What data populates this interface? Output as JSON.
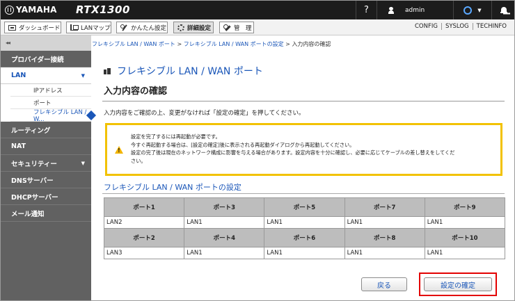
{
  "header": {
    "brand": "YAMAHA",
    "model": "RTX1300",
    "help": "?",
    "user": "admin"
  },
  "menubar": {
    "buttons": [
      {
        "label": "ダッシュボード",
        "icon": "dashboard-icon"
      },
      {
        "label": "LANマップ",
        "icon": "lanmap-icon"
      },
      {
        "label": "かんたん設定",
        "icon": "wand-icon"
      },
      {
        "label": "詳細設定",
        "icon": "gear-icon",
        "active": true
      },
      {
        "label": "管　理",
        "icon": "wrench-icon"
      }
    ],
    "right_links": [
      "CONFIG",
      "SYSLOG",
      "TECHINFO"
    ]
  },
  "sidebar": {
    "collapse": "◂◂",
    "items_top": [
      "プロバイダー接続"
    ],
    "lan": "LAN",
    "lan_sub": [
      "IPアドレス",
      "ポート",
      "フレキシブル LAN / W..."
    ],
    "items_bottom": [
      "ルーティング",
      "NAT",
      "セキュリティー",
      "DNSサーバー",
      "DHCPサーバー",
      "メール通知"
    ]
  },
  "breadcrumb": {
    "link1": "フレキシブル LAN / WAN ポート",
    "sep": " > ",
    "link2": "フレキシブル LAN / WAN ポートの設定",
    "current": "入力内容の確認"
  },
  "main": {
    "section_title": "フレキシブル LAN / WAN ポート",
    "page_title": "入力内容の確認",
    "instruction": "入力内容をご確認の上、変更がなければ「設定の確定」を押してください。",
    "warning": [
      "設定を完了するには再起動が必要です。",
      "今すぐ再起動する場合は、[設定の確定]後に表示される再起動ダイアログから再起動してください。",
      "設定の完了後は現在のネットワーク構成に影響を与える場合があります。設定内容を十分に確認し、必要に応じてケーブルの差し替えをしてくだ",
      "さい。"
    ],
    "subhead": "フレキシブル LAN / WAN ポートの設定",
    "table": {
      "row1_headers": [
        "ポート1",
        "ポート3",
        "ポート5",
        "ポート7",
        "ポート9"
      ],
      "row1_values": [
        "LAN2",
        "LAN1",
        "LAN1",
        "LAN1",
        "LAN1"
      ],
      "row2_headers": [
        "ポート2",
        "ポート4",
        "ポート6",
        "ポート8",
        "ポート10"
      ],
      "row2_values": [
        "LAN3",
        "LAN1",
        "LAN1",
        "LAN1",
        "LAN1"
      ]
    },
    "back_label": "戻る",
    "confirm_label": "設定の確定"
  },
  "colors": {
    "accent": "#1a56b8",
    "warning_border": "#f2c200",
    "highlight": "#e30000"
  }
}
